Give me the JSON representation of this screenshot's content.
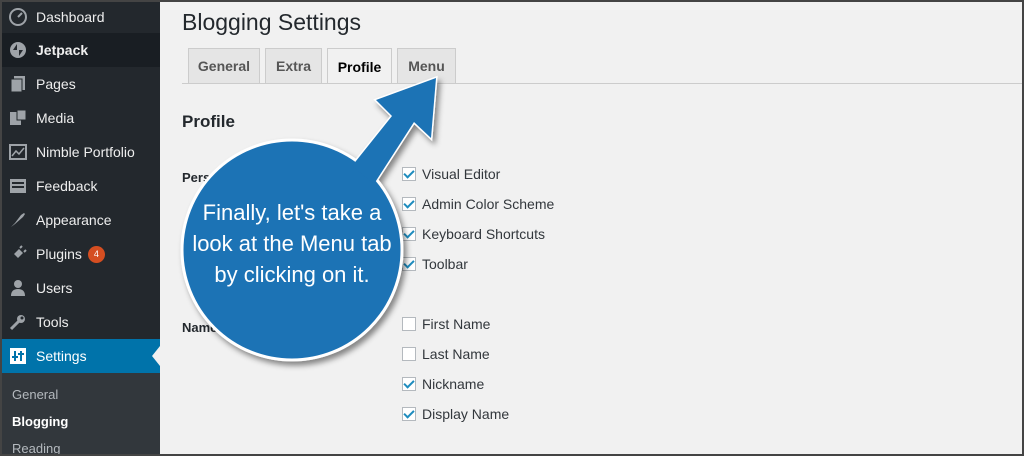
{
  "sidebar": {
    "items": [
      {
        "label": "Dashboard",
        "icon": "dashboard-icon"
      },
      {
        "label": "Jetpack",
        "icon": "jetpack-icon"
      },
      {
        "label": "Pages",
        "icon": "pages-icon"
      },
      {
        "label": "Media",
        "icon": "media-icon"
      },
      {
        "label": "Nimble Portfolio",
        "icon": "portfolio-icon"
      },
      {
        "label": "Feedback",
        "icon": "feedback-icon"
      },
      {
        "label": "Appearance",
        "icon": "appearance-icon"
      },
      {
        "label": "Plugins",
        "icon": "plugins-icon",
        "badge": "4"
      },
      {
        "label": "Users",
        "icon": "users-icon"
      },
      {
        "label": "Tools",
        "icon": "tools-icon"
      },
      {
        "label": "Settings",
        "icon": "settings-icon"
      }
    ],
    "submenu": [
      {
        "label": "General"
      },
      {
        "label": "Blogging"
      },
      {
        "label": "Reading"
      }
    ]
  },
  "page": {
    "title": "Blogging Settings",
    "tabs": [
      {
        "label": "General"
      },
      {
        "label": "Extra"
      },
      {
        "label": "Profile"
      },
      {
        "label": "Menu"
      }
    ],
    "section_title": "Profile",
    "personal_label": "Perso",
    "name_label": "Name",
    "personal_options": [
      {
        "label": "Visual Editor",
        "checked": true
      },
      {
        "label": "Admin Color Scheme",
        "checked": true
      },
      {
        "label": "Keyboard Shortcuts",
        "checked": true
      },
      {
        "label": "Toolbar",
        "checked": true
      }
    ],
    "name_options": [
      {
        "label": "First Name",
        "checked": false
      },
      {
        "label": "Last Name",
        "checked": false
      },
      {
        "label": "Nickname",
        "checked": true
      },
      {
        "label": "Display Name",
        "checked": true
      }
    ]
  },
  "callout": {
    "text": "Finally, let's take a look at the Menu tab by clicking on it.",
    "color": "#1f73b5"
  }
}
